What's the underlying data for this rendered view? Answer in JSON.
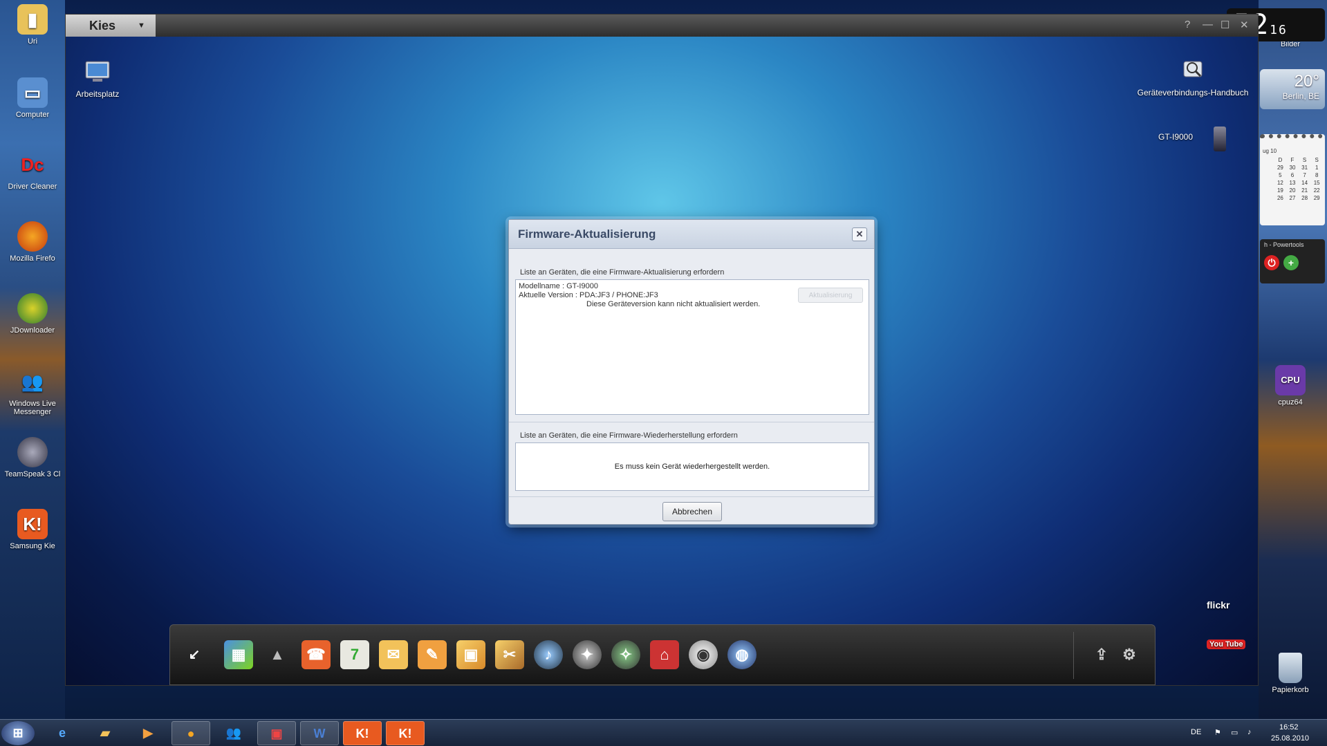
{
  "desktop": {
    "left_icons": [
      {
        "label": "Uri"
      },
      {
        "label": "Computer"
      },
      {
        "label": "Driver Cleaner"
      },
      {
        "label": "Mozilla Firefo"
      },
      {
        "label": "JDownloader"
      },
      {
        "label": "Windows Live Messenger"
      },
      {
        "label": "TeamSpeak 3 Cl"
      },
      {
        "label": "Samsung Kie"
      }
    ],
    "right_icons": [
      {
        "label": "Bilder"
      },
      {
        "label": "cpuz64"
      },
      {
        "label": "Papierkorb"
      }
    ]
  },
  "widgets": {
    "clock": {
      "main": "52",
      "seconds": "16"
    },
    "weather": {
      "temp": "20°",
      "city": "Berlin, BE"
    },
    "calendar": {
      "month": "ug 10",
      "headers": [
        "D",
        "F",
        "S",
        "S"
      ],
      "rows": [
        [
          "29",
          "30",
          "31",
          "1"
        ],
        [
          "5",
          "6",
          "7",
          "8"
        ],
        [
          "12",
          "13",
          "14",
          "15"
        ],
        [
          "19",
          "20",
          "21",
          "22"
        ],
        [
          "26",
          "27",
          "28",
          "29"
        ]
      ]
    },
    "powertools": {
      "title": "h - Powertools"
    }
  },
  "kies": {
    "logo": "Kies",
    "window_controls": {
      "help": "?",
      "minimize": "—",
      "maximize": "☐",
      "close": "✕"
    },
    "icons": {
      "my_computer": "Arbeitsplatz",
      "guide": "Geräteverbindungs-Handbuch",
      "device": "GT-I9000"
    },
    "links": {
      "flickr": "flickr",
      "youtube": "You Tube"
    }
  },
  "dialog": {
    "title": "Firmware-Aktualisierung",
    "close": "✕",
    "update_section_label": "Liste an Geräten, die eine Firmware-Aktualisierung erfordern",
    "model_line": "Modellname : GT-I9000",
    "version_line": "Aktuelle Version : PDA:JF3 / PHONE:JF3",
    "status_line": "Diese Geräteversion kann nicht aktualisiert werden.",
    "update_button": "Aktualisierung",
    "restore_section_label": "Liste an Geräten, die eine Firmware-Wiederherstellung erfordern",
    "restore_message": "Es muss kein Gerät wiederhergestellt werden.",
    "cancel_button": "Abbrechen"
  },
  "taskbar": {
    "language": "DE",
    "time": "16:52",
    "date": "25.08.2010"
  }
}
